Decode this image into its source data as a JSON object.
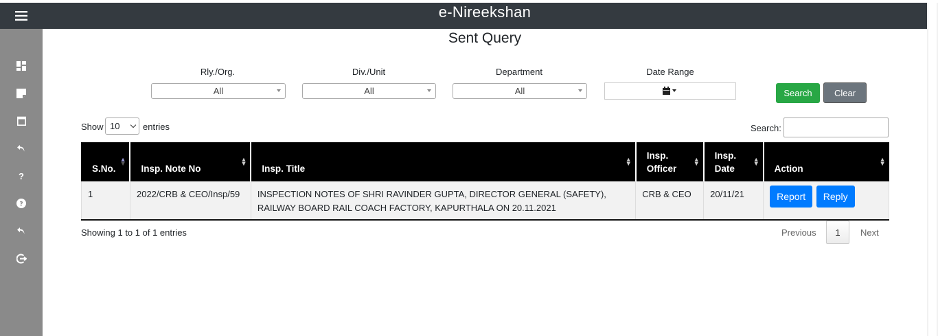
{
  "app": {
    "title": "e-Nireekshan"
  },
  "sidebar": {
    "items": [
      {
        "icon": "menu-icon"
      },
      {
        "icon": "dashboard-icon"
      },
      {
        "icon": "note-icon"
      },
      {
        "icon": "calendar-icon"
      },
      {
        "icon": "reply-icon"
      },
      {
        "icon": "question-icon"
      },
      {
        "icon": "help-circle-icon"
      },
      {
        "icon": "reply-icon"
      },
      {
        "icon": "logout-icon"
      }
    ]
  },
  "page": {
    "title": "Sent Query"
  },
  "filters": {
    "rly_label": "Rly./Org.",
    "rly_value": "All",
    "div_label": "Div./Unit",
    "div_value": "All",
    "dept_label": "Department",
    "dept_value": "All",
    "date_label": "Date Range",
    "search_btn": "Search",
    "clear_btn": "Clear"
  },
  "table_controls": {
    "show_label": "Show",
    "entries_value": "10",
    "entries_label": "entries",
    "search_label": "Search:"
  },
  "table": {
    "headers": [
      "S.No.",
      "Insp. Note No",
      "Insp. Title",
      "Insp. Officer",
      "Insp. Date",
      "Action"
    ],
    "headers_wrapped": {
      "officer_1": "Insp.",
      "officer_2": "Officer",
      "date_1": "Insp.",
      "date_2": "Date"
    },
    "rows": [
      {
        "sno": "1",
        "note_no": "2022/CRB & CEO/Insp/59",
        "title": "INSPECTION NOTES OF SHRI RAVINDER GUPTA, DIRECTOR GENERAL (SAFETY), RAILWAY BOARD RAIL COACH FACTORY, KAPURTHALA ON 20.11.2021",
        "officer": "CRB & CEO",
        "date": "20/11/21",
        "actions": [
          "Report",
          "Reply"
        ]
      }
    ]
  },
  "footer": {
    "info": "Showing 1 to 1 of 1 entries",
    "previous": "Previous",
    "page": "1",
    "next": "Next"
  },
  "colors": {
    "header_bg": "#343a40",
    "sidebar_bg": "#8a8a8a",
    "search_btn": "#28a745",
    "clear_btn": "#6c757d",
    "action_btn": "#007bff"
  }
}
